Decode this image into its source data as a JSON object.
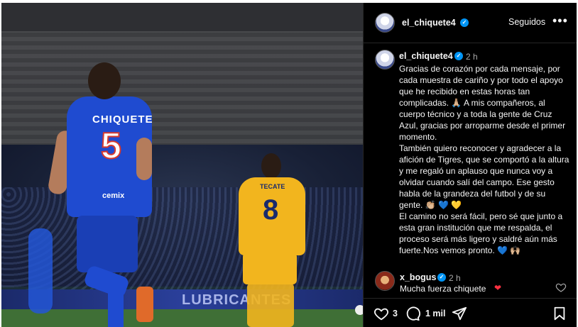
{
  "image": {
    "jersey_name": "CHIQUETE",
    "jersey_number": "5",
    "jersey_sponsor": "cemix",
    "opponent_jersey_name": "TECATE",
    "opponent_jersey_number": "8",
    "banner_text": "LUBRICANTES"
  },
  "header": {
    "username": "el_chiquete4",
    "follow_label": "Seguidos",
    "more_label": "•••"
  },
  "caption": {
    "username": "el_chiquete4",
    "time": "2 h",
    "paragraph1": "Gracias de corazón por cada mensaje, por cada muestra de cariño y por todo el apoyo que he recibido en estas horas tan complicadas. 🙏🏼 A mis compañeros, al cuerpo técnico y a toda la gente de Cruz Azul, gracias por arroparme desde el primer momento.",
    "paragraph2": "También quiero reconocer y agradecer a la afición de Tigres, que se comportó a la altura y me regaló un aplauso que nunca voy a olvidar cuando salí del campo. Ese gesto habla de la grandeza del futbol y de su gente. 👏🏼 💙 💛",
    "paragraph3": "El camino no será fácil, pero sé que junto a esta gran institución que me respalda, el proceso será más ligero y saldré aún más fuerte.Nos vemos pronto. 💙 🙌🏼"
  },
  "comment": {
    "username": "x_bogus",
    "time": "2 h",
    "text": "Mucha fuerza chiquete",
    "emoji": "❤"
  },
  "actions": {
    "likes": "3",
    "comments": "1 mil"
  },
  "colors": {
    "verified": "#0095f6",
    "background": "#000000",
    "secondary_text": "#a8a8a8"
  }
}
